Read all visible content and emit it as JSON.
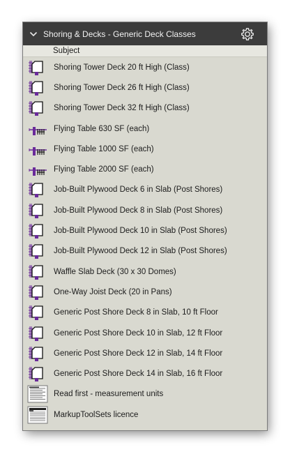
{
  "panel": {
    "title": "Shoring & Decks - Generic Deck Classes",
    "column_header": "Subject"
  },
  "items": [
    {
      "label": "Shoring Tower Deck 20 ft High (Class)",
      "icon": "deck-tower-icon"
    },
    {
      "label": "Shoring Tower Deck 26 ft High (Class)",
      "icon": "deck-tower-icon"
    },
    {
      "label": "Shoring Tower Deck 32 ft High (Class)",
      "icon": "deck-tower-icon"
    },
    {
      "label": "Flying Table 630 SF (each)",
      "icon": "flying-table-icon"
    },
    {
      "label": "Flying Table 1000 SF (each)",
      "icon": "flying-table-icon"
    },
    {
      "label": "Flying Table 2000 SF (each)",
      "icon": "flying-table-icon"
    },
    {
      "label": "Job-Built Plywood Deck 6 in Slab (Post Shores)",
      "icon": "deck-tower-icon"
    },
    {
      "label": "Job-Built Plywood Deck 8 in Slab (Post Shores)",
      "icon": "deck-tower-icon"
    },
    {
      "label": "Job-Built Plywood Deck 10 in Slab (Post Shores)",
      "icon": "deck-tower-icon"
    },
    {
      "label": "Job-Built Plywood Deck 12 in Slab (Post Shores)",
      "icon": "deck-tower-icon"
    },
    {
      "label": "Waffle Slab Deck (30 x 30 Domes)",
      "icon": "deck-tower-icon"
    },
    {
      "label": "One-Way Joist Deck (20 in Pans)",
      "icon": "deck-tower-icon"
    },
    {
      "label": "Generic Post Shore Deck 8 in Slab, 10 ft Floor",
      "icon": "deck-tower-icon"
    },
    {
      "label": "Generic Post Shore Deck 10 in Slab, 12 ft Floor",
      "icon": "deck-tower-icon"
    },
    {
      "label": "Generic Post Shore Deck 12 in Slab, 14 ft Floor",
      "icon": "deck-tower-icon"
    },
    {
      "label": "Generic Post Shore Deck 14 in Slab, 16 ft Floor",
      "icon": "deck-tower-icon"
    },
    {
      "label": "Read first - measurement units",
      "icon": "document-thumbnail-icon"
    },
    {
      "label": "MarkupToolSets licence",
      "icon": "license-thumbnail-icon"
    }
  ],
  "colors": {
    "titlebar": "#3c3c3c",
    "panel_bg": "#d9d9d0",
    "icon_purple": "#6a2a9a"
  }
}
